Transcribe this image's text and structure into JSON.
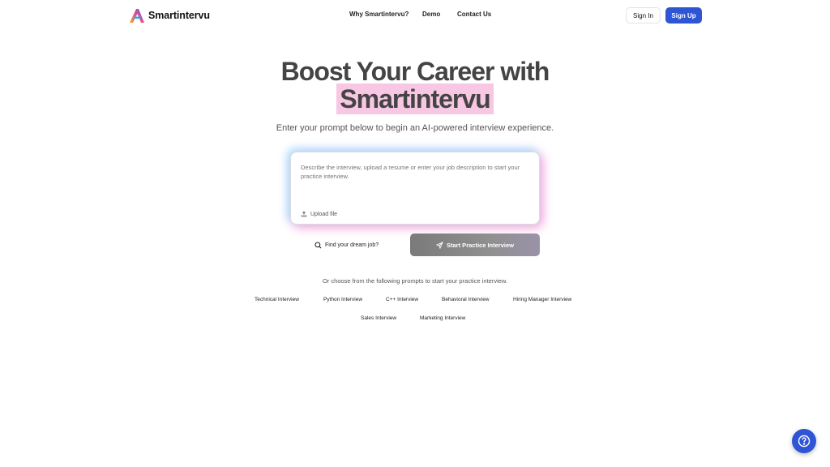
{
  "header": {
    "brand": "Smartintervu",
    "nav": [
      "Why Smartintervu?",
      "Demo",
      "Contact Us"
    ],
    "sign_in": "Sign In",
    "sign_up": "Sign Up"
  },
  "hero": {
    "title_line1": "Boost Your Career with",
    "title_highlight": "Smartintervu",
    "subtitle": "Enter your prompt below to begin an AI-powered interview experience."
  },
  "prompt": {
    "placeholder": "Describe the interview, upload a resume or enter your job description to start your practice interview.",
    "upload_label": "Upload file"
  },
  "actions": {
    "find_job": "Find your dream job?",
    "start": "Start Practice Interview"
  },
  "suggestions": {
    "intro": "Or choose from the following prompts to start your practice interview.",
    "items": [
      "Technical Interview",
      "Python Interview",
      "C++ Interview",
      "Behavioral Interview",
      "Hiring Manager Interview",
      "Sales Interview",
      "Marketing Interview"
    ]
  },
  "colors": {
    "primary": "#2f55d4",
    "highlight": "#f7c7e3",
    "title_text": "#444444"
  },
  "icons": {
    "logo": "smartintervu-logo-icon",
    "upload": "upload-icon",
    "search": "search-icon",
    "send": "send-icon",
    "help": "help-icon"
  }
}
